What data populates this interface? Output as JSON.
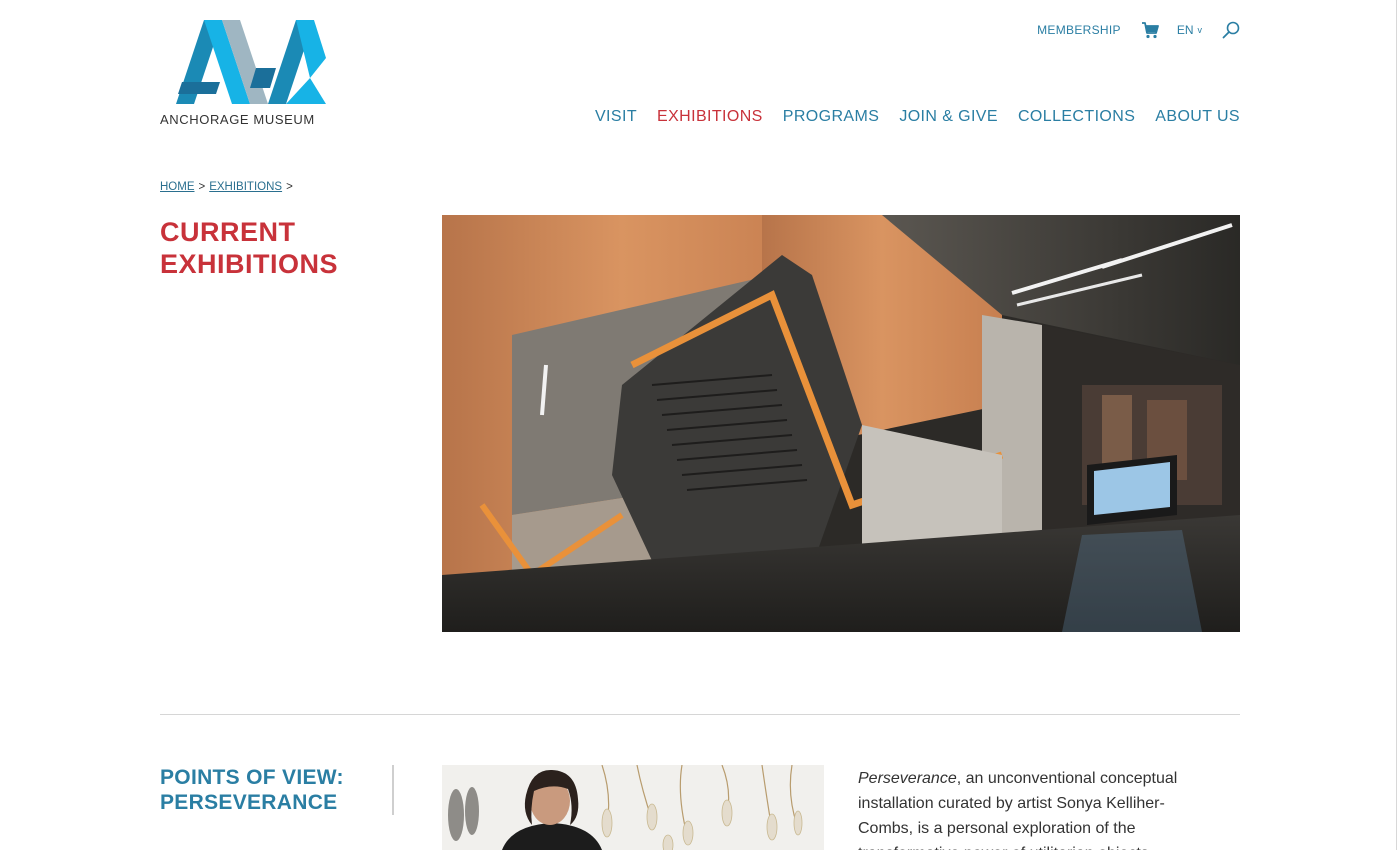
{
  "brand": {
    "name": "ANCHORAGE MUSEUM",
    "colors": {
      "logo_dark": "#1b8ab5",
      "logo_light": "#17b3e6",
      "logo_gray": "#9fb6c2",
      "accent_red": "#c8323a",
      "link_blue": "#2a7ea3"
    }
  },
  "utility_nav": {
    "membership": "MEMBERSHIP",
    "cart_icon": "shopping-cart-icon",
    "language": "EN",
    "language_caret": "v",
    "search_icon": "search-icon"
  },
  "main_nav": {
    "items": [
      {
        "label": "VISIT",
        "active": false
      },
      {
        "label": "EXHIBITIONS",
        "active": true
      },
      {
        "label": "PROGRAMS",
        "active": false
      },
      {
        "label": "JOIN & GIVE",
        "active": false
      },
      {
        "label": "COLLECTIONS",
        "active": false
      },
      {
        "label": "ABOUT US",
        "active": false
      }
    ]
  },
  "breadcrumb": {
    "items": [
      "HOME",
      "EXHIBITIONS"
    ],
    "separator": ">"
  },
  "page": {
    "title_line1": "CURRENT",
    "title_line2": "EXHIBITIONS"
  },
  "exhibitions": [
    {
      "title_line1": "POINTS OF VIEW:",
      "title_line2": "PERSEVERANCE",
      "desc_italic": "Perseverance",
      "desc_rest": ", an unconventional conceptual installation curated by artist Sonya Kelliher-Combs, is a personal exploration of the transformative power of utilitarian objects"
    }
  ]
}
